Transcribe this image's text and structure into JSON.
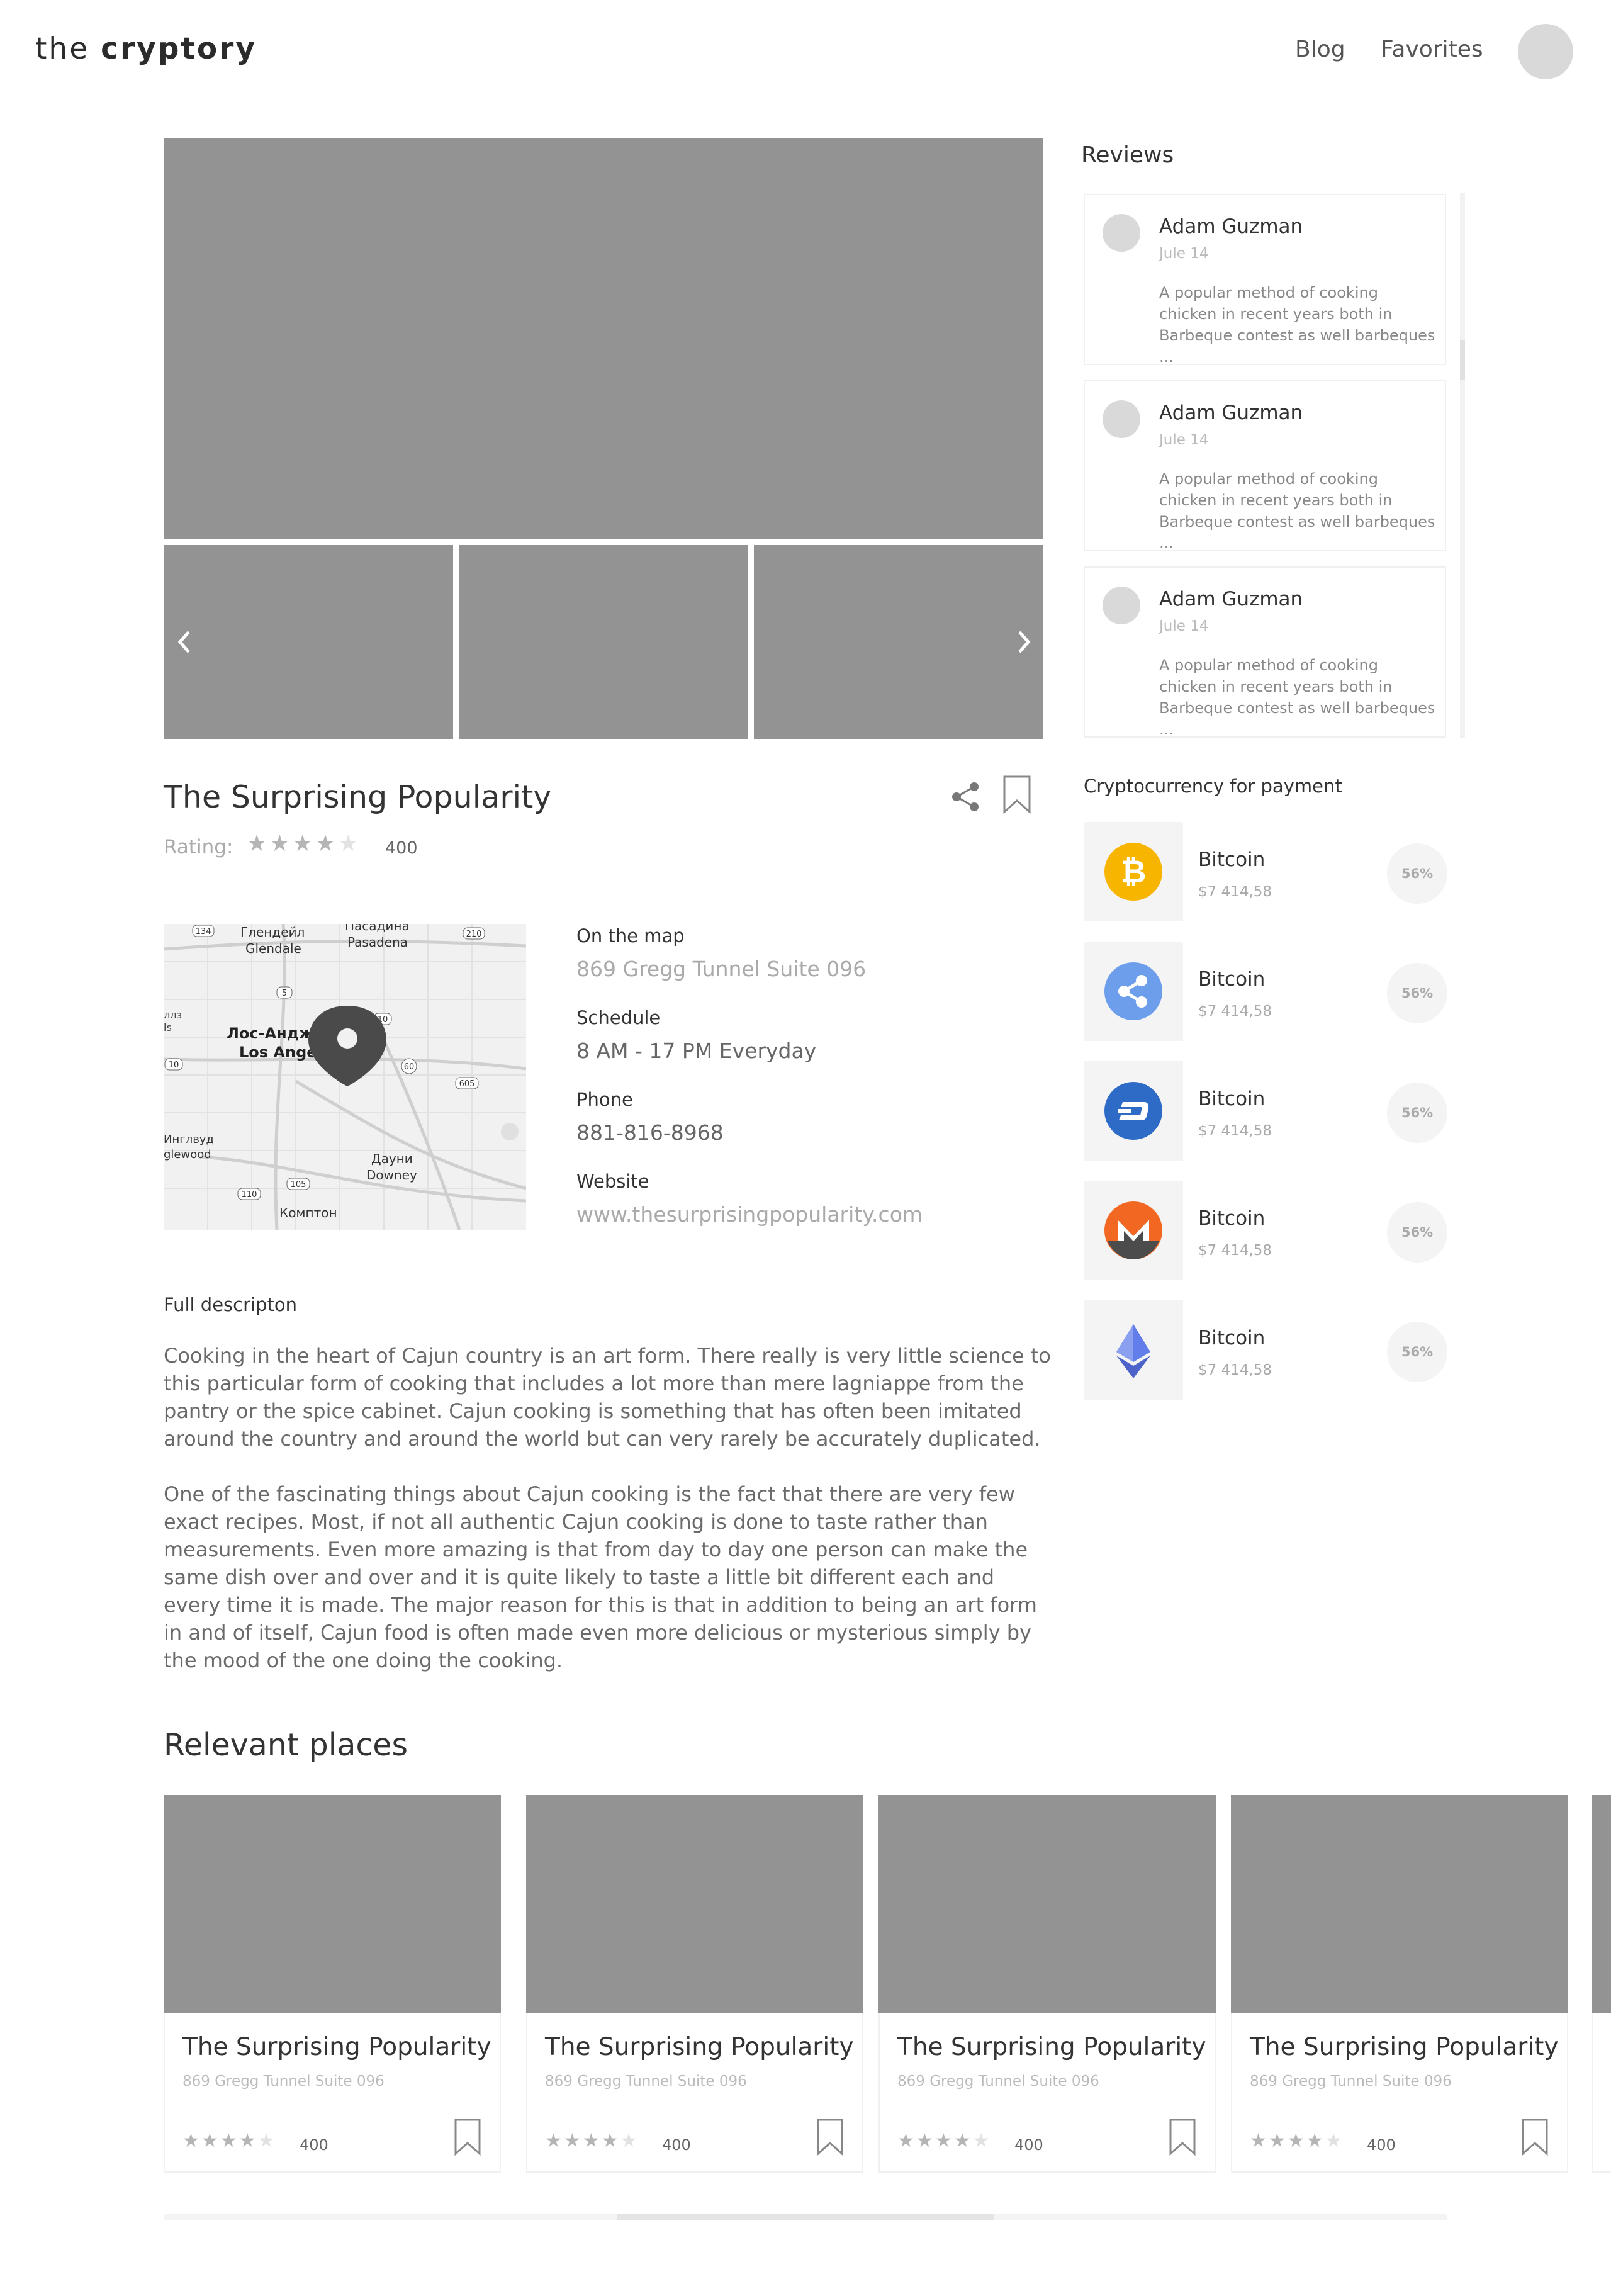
{
  "header": {
    "logo_light": "the",
    "logo_bold": "cryptory",
    "nav": [
      "Blog",
      "Favorites"
    ]
  },
  "place": {
    "title": "The Surprising Popularity",
    "rating_label": "Rating:",
    "rating_stars": 4,
    "rating_count": "400"
  },
  "map_labels": {
    "glendale_ru": "Глендейл",
    "glendale": "Glendale",
    "pasadena_ru": "Пасадина",
    "pasadena": "Pasadena",
    "la_ru": "Лос-Анджелес",
    "la": "Los Angeles",
    "inglewood_ru": "Инглвуд",
    "inglewood": "glewood",
    "downey_ru": "Дауни",
    "downey": "Downey",
    "compton_ru": "Комптон",
    "hills_ru": "ллз",
    "hills": "ls",
    "road_134": "134",
    "road_210": "210",
    "road_5": "5",
    "road_10a": "10",
    "road_10b": "10",
    "road_60": "60",
    "road_605": "605",
    "road_105": "105",
    "road_110": "110"
  },
  "info": {
    "map_label": "On the map",
    "map_value": "869 Gregg Tunnel Suite 096",
    "schedule_label": "Schedule",
    "schedule_value": "8 AM - 17 PM Everyday",
    "phone_label": "Phone",
    "phone_value": "881-816-8968",
    "website_label": "Website",
    "website_value": "www.thesurprisingpopularity.com"
  },
  "description": {
    "title": "Full descripton",
    "paragraphs": [
      "Cooking in the heart of Cajun country is an art form. There really is very little science to this particular form of cooking that includes a lot more than mere lagniappe from the pantry or the spice cabinet. Cajun cooking is something that has often been imitated around the country and around the world but can very rarely be accurately duplicated.",
      "One of the fascinating things about Cajun cooking is the fact that there are very few exact recipes. Most, if not all authentic Cajun cooking is done to taste rather than measurements. Even more amazing is that from day to day one person can make the same dish over and over and it is quite likely to taste a little bit different each and every time it is made. The major reason for this is that in addition to being an art form in and of itself, Cajun food is often made even more delicious or mysterious simply by the mood of the one doing the cooking."
    ]
  },
  "reviews": {
    "title": "Reviews",
    "items": [
      {
        "name": "Adam Guzman",
        "date": "Jule 14",
        "text": "A popular method of cooking chicken in recent years both in Barbeque contest as well barbeques ..."
      },
      {
        "name": "Adam Guzman",
        "date": "Jule 14",
        "text": "A popular method of cooking chicken in recent years both in Barbeque contest as well barbeques ..."
      },
      {
        "name": "Adam Guzman",
        "date": "Jule 14",
        "text": "A popular method of cooking chicken in recent years both in Barbeque contest as well barbeques ..."
      }
    ]
  },
  "crypto": {
    "title": "Cryptocurrency for payment",
    "items": [
      {
        "name": "Bitcoin",
        "price": "$7 414,58",
        "pct": "56%",
        "icon": "bitcoin-icon",
        "color": "#F7B500"
      },
      {
        "name": "Bitcoin",
        "price": "$7 414,58",
        "pct": "56%",
        "icon": "ripple-icon",
        "color": "#6D9EEB"
      },
      {
        "name": "Bitcoin",
        "price": "$7 414,58",
        "pct": "56%",
        "icon": "dash-icon",
        "color": "#2E6BC6"
      },
      {
        "name": "Bitcoin",
        "price": "$7 414,58",
        "pct": "56%",
        "icon": "monero-icon",
        "color": "#F26822"
      },
      {
        "name": "Bitcoin",
        "price": "$7 414,58",
        "pct": "56%",
        "icon": "ethereum-icon",
        "color": "#627EEA"
      }
    ]
  },
  "relevant": {
    "title": "Relevant places",
    "cards": [
      {
        "title": "The Surprising Popularity",
        "address": "869 Gregg Tunnel Suite 096",
        "stars": 4,
        "count": "400"
      },
      {
        "title": "The Surprising Popularity",
        "address": "869 Gregg Tunnel Suite 096",
        "stars": 4,
        "count": "400"
      },
      {
        "title": "The Surprising Popularity",
        "address": "869 Gregg Tunnel Suite 096",
        "stars": 4,
        "count": "400"
      },
      {
        "title": "The Surprising Popularity",
        "address": "869 Gregg Tunnel Suite 096",
        "stars": 4,
        "count": "400"
      }
    ]
  }
}
